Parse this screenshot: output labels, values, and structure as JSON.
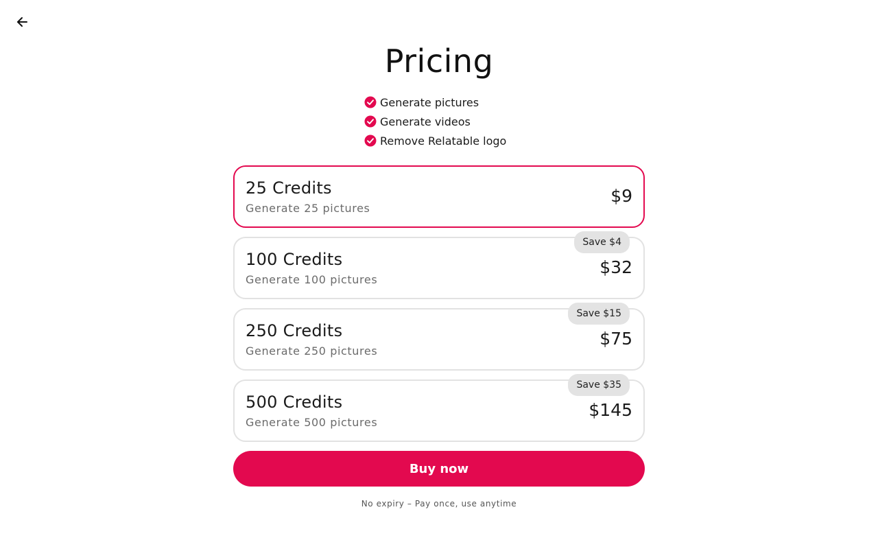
{
  "header": {
    "back_icon": "arrow-left-icon"
  },
  "page": {
    "title": "Pricing"
  },
  "features": [
    {
      "icon": "check-circle-icon",
      "label": "Generate pictures"
    },
    {
      "icon": "check-circle-icon",
      "label": "Generate videos"
    },
    {
      "icon": "check-circle-icon",
      "label": "Remove Relatable logo"
    }
  ],
  "plans": [
    {
      "name": "25 Credits",
      "description": "Generate 25 pictures",
      "price": "$9",
      "badge": "",
      "selected": true
    },
    {
      "name": "100 Credits",
      "description": "Generate 100 pictures",
      "price": "$32",
      "badge": "Save $4",
      "selected": false
    },
    {
      "name": "250 Credits",
      "description": "Generate 250 pictures",
      "price": "$75",
      "badge": "Save $15",
      "selected": false
    },
    {
      "name": "500 Credits",
      "description": "Generate 500 pictures",
      "price": "$145",
      "badge": "Save $35",
      "selected": false
    }
  ],
  "cta": {
    "buy_label": "Buy now"
  },
  "footer": {
    "note": "No expiry – Pay once, use anytime"
  },
  "colors": {
    "accent": "#e3094f",
    "badge_bg": "#e3e3e3",
    "border": "#e2e2e2"
  }
}
